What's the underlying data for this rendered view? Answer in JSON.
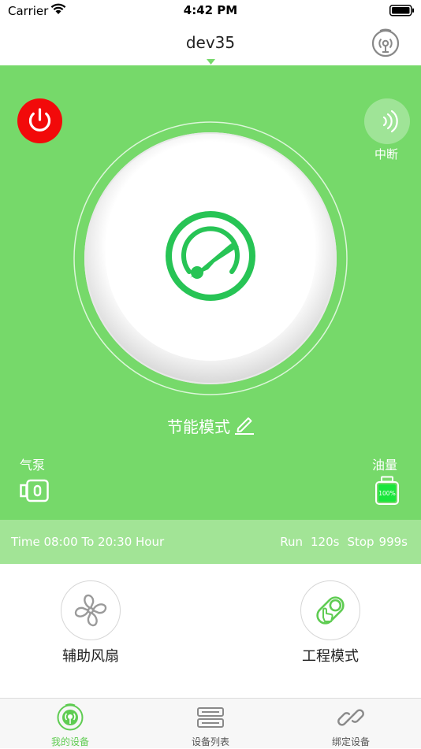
{
  "status_bar": {
    "carrier": "Carrier",
    "time": "4:42 PM"
  },
  "nav": {
    "title": "dev35"
  },
  "controls": {
    "interrupt_label": "中断",
    "mode_label": "节能模式",
    "pump_label": "气泵",
    "oil_label": "油量",
    "oil_level_text": "100%",
    "oil_level_fraction": 1.0
  },
  "schedule": {
    "time_text": "Time 08:00 To 20:30 Hour",
    "run_label": "Run",
    "run_value": "120s",
    "stop_label": "Stop",
    "stop_value": "999s"
  },
  "functions": {
    "fan_label": "辅助风扇",
    "engineering_label": "工程模式"
  },
  "tabs": [
    {
      "label": "我的设备",
      "icon": "signal-icon",
      "active": true
    },
    {
      "label": "设备列表",
      "icon": "server-list-icon",
      "active": false
    },
    {
      "label": "绑定设备",
      "icon": "link-icon",
      "active": false
    }
  ],
  "colors": {
    "primary_green": "#76d96a",
    "strip_green": "#a2e496",
    "power_red": "#f20a0a",
    "gauge_green": "#27c455",
    "tab_active": "#5fcc52"
  }
}
